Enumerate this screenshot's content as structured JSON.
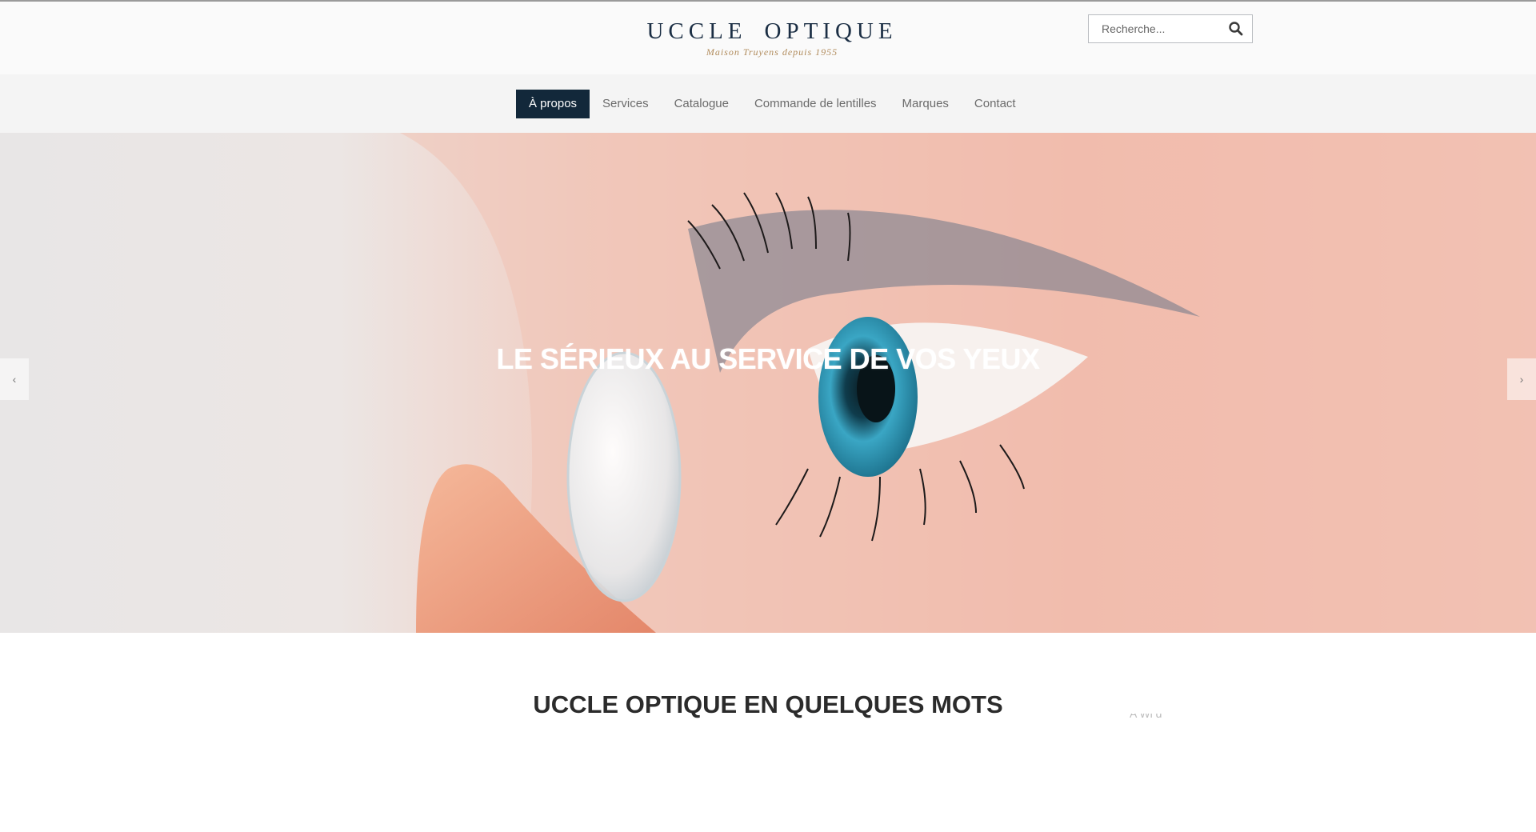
{
  "header": {
    "logo": {
      "word1": "UCCLE",
      "word2": "OPTIQUE",
      "tagline": "Maison Truyens depuis 1955",
      "icon": "eye-logo-icon"
    },
    "search": {
      "placeholder": "Recherche...",
      "icon": "search-icon"
    }
  },
  "nav": {
    "items": [
      {
        "label": "À propos",
        "active": true
      },
      {
        "label": "Services",
        "active": false
      },
      {
        "label": "Catalogue",
        "active": false
      },
      {
        "label": "Commande de lentilles",
        "active": false
      },
      {
        "label": "Marques",
        "active": false
      },
      {
        "label": "Contact",
        "active": false
      }
    ],
    "active_color": "#12283a"
  },
  "hero": {
    "title": "LE SÉRIEUX AU SERVICE DE VOS YEUX",
    "prev_icon": "‹",
    "next_icon": "›"
  },
  "section": {
    "title": "UCCLE OPTIQUE EN QUELQUES MOTS",
    "side_text": "A         Wi d"
  }
}
